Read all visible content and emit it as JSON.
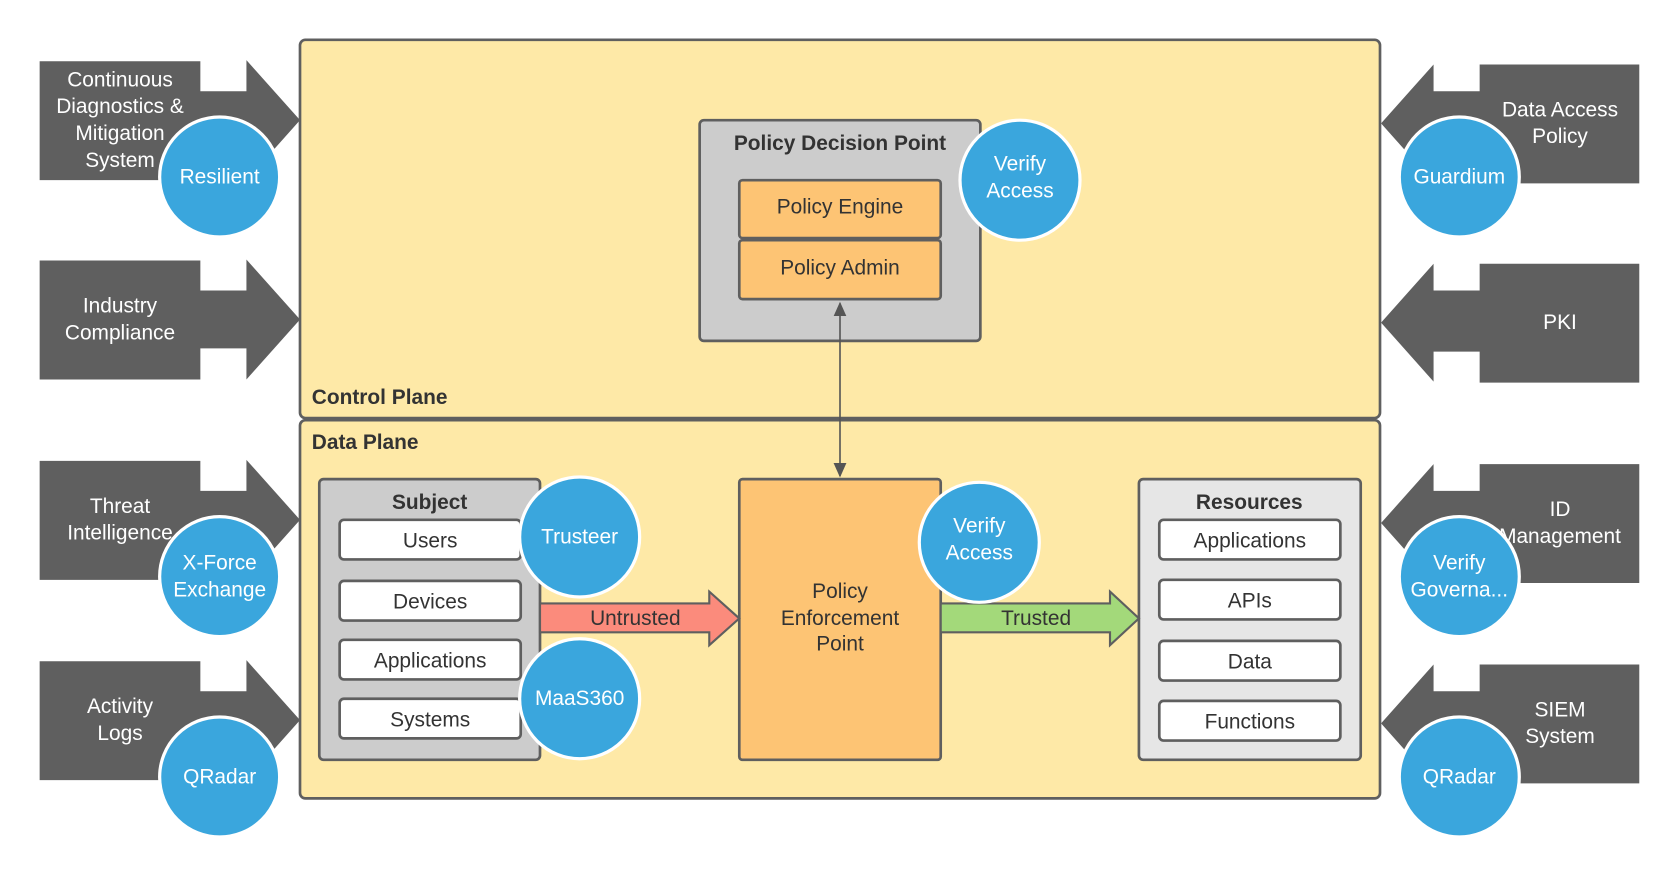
{
  "colors": {
    "plane": "#fee9a7",
    "arrow": "#5f5f5f",
    "circle": "#3aa6dd",
    "orange": "#fdc474",
    "untrusted": "#fb8b7c",
    "trusted": "#a3d97a"
  },
  "control_plane": {
    "label": "Control Plane",
    "pdp": {
      "title": "Policy Decision Point",
      "engine": "Policy Engine",
      "admin": "Policy Admin"
    },
    "badge": [
      "Verify",
      "Access"
    ]
  },
  "data_plane": {
    "label": "Data Plane",
    "subject": {
      "title": "Subject",
      "items": [
        "Users",
        "Devices",
        "Applications",
        "Systems"
      ],
      "badges": [
        "Trusteer",
        "MaaS360"
      ]
    },
    "pep": {
      "lines": [
        "Policy",
        "Enforcement",
        "Point"
      ],
      "badge": [
        "Verify",
        "Access"
      ]
    },
    "resources": {
      "title": "Resources",
      "items": [
        "Applications",
        "APIs",
        "Data",
        "Functions"
      ]
    },
    "untrusted": "Untrusted",
    "trusted": "Trusted"
  },
  "left_inputs": [
    {
      "lines": [
        "Continuous",
        "Diagnostics &",
        "Mitigation",
        "System"
      ],
      "badge": [
        "Resilient"
      ]
    },
    {
      "lines": [
        "Industry",
        "Compliance"
      ],
      "badge": []
    },
    {
      "lines": [
        "Threat",
        "Intelligence"
      ],
      "badge": [
        "X-Force",
        "Exchange"
      ]
    },
    {
      "lines": [
        "Activity",
        "Logs"
      ],
      "badge": [
        "QRadar"
      ]
    }
  ],
  "right_inputs": [
    {
      "lines": [
        "Data Access",
        "Policy"
      ],
      "badge": [
        "Guardium"
      ]
    },
    {
      "lines": [
        "PKI"
      ],
      "badge": []
    },
    {
      "lines": [
        "ID",
        "Management"
      ],
      "badge": [
        "Verify",
        "Governa..."
      ]
    },
    {
      "lines": [
        "SIEM",
        "System"
      ],
      "badge": [
        "QRadar"
      ]
    }
  ]
}
